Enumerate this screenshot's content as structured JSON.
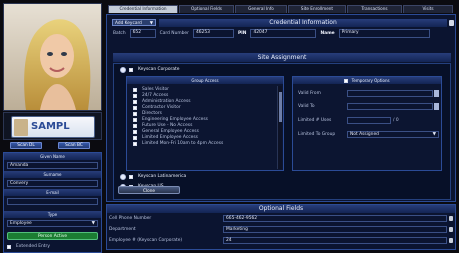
{
  "tabs": [
    {
      "label": "Credential Information"
    },
    {
      "label": "Optional Fields"
    },
    {
      "label": "General Info"
    },
    {
      "label": "Site Enrollment"
    },
    {
      "label": "Transactions"
    },
    {
      "label": "Visits"
    }
  ],
  "credential": {
    "add_keycard_label": "Add Keycard",
    "header": "Credential Information",
    "batch_label": "Batch",
    "batch_value": "652",
    "card_number_label": "Card Number",
    "card_number_value": "46253",
    "pin_label": "PIN",
    "pin_value": "42047",
    "name_label": "Name",
    "name_value": "Primary"
  },
  "site_assignment": {
    "header": "Site Assignment",
    "sites": [
      {
        "label": "Keyscan Corporate"
      },
      {
        "label": "Keyscan Latinamerica"
      },
      {
        "label": "Keyscan US"
      }
    ],
    "group_access_header": "Group Access",
    "group_access_items": [
      "Sales Visitor",
      "24/7 Access",
      "Administration Access",
      "Contractor Visitor",
      "Directors",
      "Engineering Employee Access",
      "Future Use - No Access",
      "General Employee Access",
      "Limited Employee Access",
      "Limited Mon-Fri 10am to 4pm Access"
    ],
    "temporary_options_header": "Temporary Options",
    "valid_from_label": "Valid From",
    "valid_to_label": "Valid To",
    "limited_uses_label": "Limited # Uses",
    "limited_uses_suffix": "/ 0",
    "limited_to_group_label": "Limited To Group",
    "limited_to_group_value": "Not Assigned",
    "clone_label": "Clone"
  },
  "left": {
    "scan_dl_label": "Scan DL",
    "scan_bc_label": "Scan BC",
    "given_name_label": "Given Name",
    "given_name_value": "Amanda",
    "surname_label": "Surname",
    "surname_value": "Convery",
    "email_label": "E-mail",
    "email_value": "",
    "type_label": "Type",
    "type_value": "Employee",
    "status_value": "Person Active",
    "extended_entry_label": "Extended Entry",
    "license_plate_text": "SAMPL"
  },
  "optional_fields": {
    "header": "Optional Fields",
    "rows": [
      {
        "label": "Cell Phone Number",
        "value": "665-462-9562"
      },
      {
        "label": "Department",
        "value": "Marketing"
      },
      {
        "label": "Employee # (Keyscan Corporate)",
        "value": "24"
      }
    ]
  },
  "colors": {
    "accent": "#2b4b96",
    "header": "#1c3270",
    "background": "#0b0b10"
  }
}
